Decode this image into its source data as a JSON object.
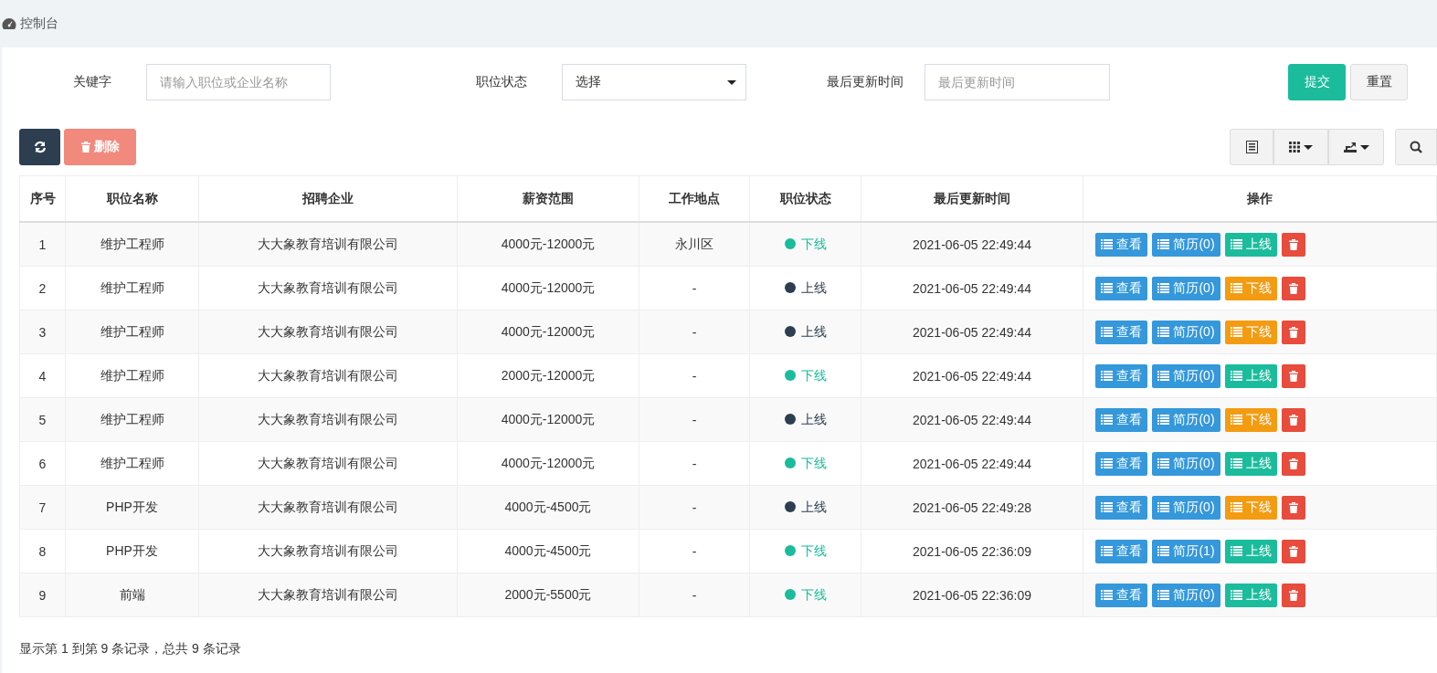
{
  "breadcrumb": {
    "title": "控制台"
  },
  "filters": {
    "keyword": {
      "label": "关键字",
      "placeholder": "请输入职位或企业名称"
    },
    "status": {
      "label": "职位状态",
      "value": "选择"
    },
    "updated": {
      "label": "最后更新时间",
      "placeholder": "最后更新时间"
    },
    "submit": "提交",
    "reset": "重置"
  },
  "toolbar": {
    "delete": "删除"
  },
  "table": {
    "columns": [
      "序号",
      "职位名称",
      "招聘企业",
      "薪资范围",
      "工作地点",
      "职位状态",
      "最后更新时间",
      "操作"
    ],
    "rows": [
      {
        "index": "1",
        "title": "维护工程师",
        "company": "大大象教育培训有限公司",
        "salary": "4000元-12000元",
        "location": "永川区",
        "status": {
          "label": "下线",
          "color": "#1abc9c"
        },
        "updated": "2021-06-05 22:49:44",
        "view": "查看",
        "resume": "简历(0)",
        "toggle": {
          "kind": "online",
          "label": "上线"
        }
      },
      {
        "index": "2",
        "title": "维护工程师",
        "company": "大大象教育培训有限公司",
        "salary": "4000元-12000元",
        "location": "-",
        "status": {
          "label": "上线",
          "color": "#2c3e50"
        },
        "updated": "2021-06-05 22:49:44",
        "view": "查看",
        "resume": "简历(0)",
        "toggle": {
          "kind": "offline",
          "label": "下线"
        }
      },
      {
        "index": "3",
        "title": "维护工程师",
        "company": "大大象教育培训有限公司",
        "salary": "4000元-12000元",
        "location": "-",
        "status": {
          "label": "上线",
          "color": "#2c3e50"
        },
        "updated": "2021-06-05 22:49:44",
        "view": "查看",
        "resume": "简历(0)",
        "toggle": {
          "kind": "offline",
          "label": "下线"
        }
      },
      {
        "index": "4",
        "title": "维护工程师",
        "company": "大大象教育培训有限公司",
        "salary": "2000元-12000元",
        "location": "-",
        "status": {
          "label": "下线",
          "color": "#1abc9c"
        },
        "updated": "2021-06-05 22:49:44",
        "view": "查看",
        "resume": "简历(0)",
        "toggle": {
          "kind": "online",
          "label": "上线"
        }
      },
      {
        "index": "5",
        "title": "维护工程师",
        "company": "大大象教育培训有限公司",
        "salary": "4000元-12000元",
        "location": "-",
        "status": {
          "label": "上线",
          "color": "#2c3e50"
        },
        "updated": "2021-06-05 22:49:44",
        "view": "查看",
        "resume": "简历(0)",
        "toggle": {
          "kind": "offline",
          "label": "下线"
        }
      },
      {
        "index": "6",
        "title": "维护工程师",
        "company": "大大象教育培训有限公司",
        "salary": "4000元-12000元",
        "location": "-",
        "status": {
          "label": "下线",
          "color": "#1abc9c"
        },
        "updated": "2021-06-05 22:49:44",
        "view": "查看",
        "resume": "简历(0)",
        "toggle": {
          "kind": "online",
          "label": "上线"
        }
      },
      {
        "index": "7",
        "title": "PHP开发",
        "company": "大大象教育培训有限公司",
        "salary": "4000元-4500元",
        "location": "-",
        "status": {
          "label": "上线",
          "color": "#2c3e50"
        },
        "updated": "2021-06-05 22:49:28",
        "view": "查看",
        "resume": "简历(0)",
        "toggle": {
          "kind": "offline",
          "label": "下线"
        }
      },
      {
        "index": "8",
        "title": "PHP开发",
        "company": "大大象教育培训有限公司",
        "salary": "4000元-4500元",
        "location": "-",
        "status": {
          "label": "下线",
          "color": "#1abc9c"
        },
        "updated": "2021-06-05 22:36:09",
        "view": "查看",
        "resume": "简历(1)",
        "toggle": {
          "kind": "online",
          "label": "上线"
        }
      },
      {
        "index": "9",
        "title": "前端",
        "company": "大大象教育培训有限公司",
        "salary": "2000元-5500元",
        "location": "-",
        "status": {
          "label": "下线",
          "color": "#1abc9c"
        },
        "updated": "2021-06-05 22:36:09",
        "view": "查看",
        "resume": "简历(0)",
        "toggle": {
          "kind": "online",
          "label": "上线"
        }
      }
    ]
  },
  "pagination": {
    "summary": "显示第 1 到第 9 条记录，总共 9 条记录"
  }
}
